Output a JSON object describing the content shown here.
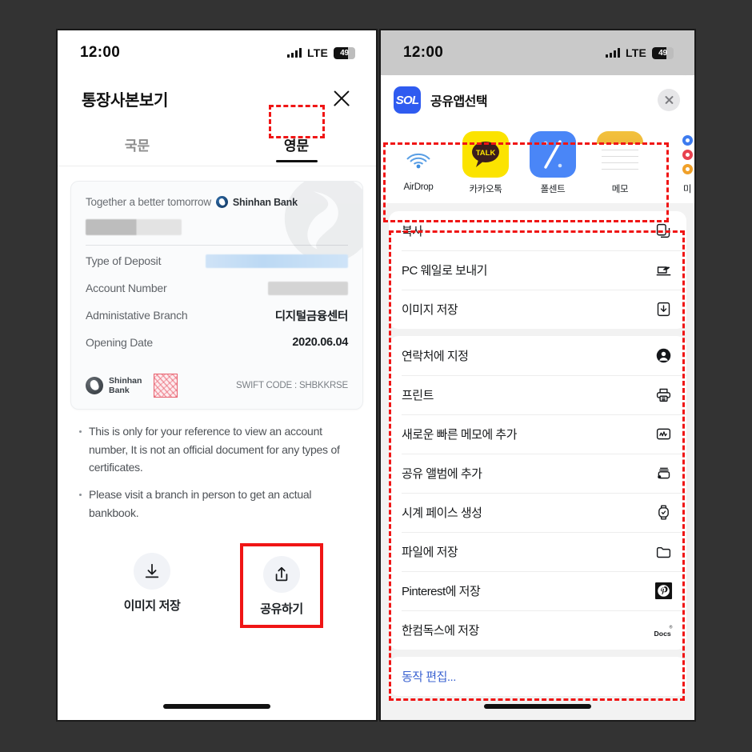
{
  "statusbar": {
    "time": "12:00",
    "network": "LTE",
    "battery": "49"
  },
  "left_phone": {
    "header": {
      "title": "통장사본보기",
      "close_icon": "close-icon"
    },
    "tabs": [
      {
        "label": "국문",
        "active": false
      },
      {
        "label": "영문",
        "active": true
      }
    ],
    "bank_card": {
      "tagline": "Together a better tomorrow",
      "brand": "Shinhan Bank",
      "name_masked": true,
      "rows": [
        {
          "label": "Type of Deposit",
          "value": "",
          "masked": "blue"
        },
        {
          "label": "Account Number",
          "value": "",
          "masked": "gray"
        },
        {
          "label": "Administative Branch",
          "value": "디지털금융센터",
          "masked": ""
        },
        {
          "label": "Opening Date",
          "value": "2020.06.04",
          "masked": ""
        }
      ],
      "footer_brand_line1": "Shinhan",
      "footer_brand_line2": "Bank",
      "swift": "SWIFT CODE : SHBKKRSE"
    },
    "notes": [
      "This is only for your reference to view an account number, It is not an official document for any types of certificates.",
      "Please visit a branch in person to get an actual bankbook."
    ],
    "actions": [
      {
        "label": "이미지 저장",
        "icon": "download-icon",
        "highlighted": false
      },
      {
        "label": "공유하기",
        "icon": "share-icon",
        "highlighted": true
      }
    ]
  },
  "right_phone": {
    "sheet_header": {
      "app_name": "SOL",
      "title": "공유앱선택",
      "close_icon": "close-icon"
    },
    "apps": [
      {
        "label": "AirDrop",
        "icon": "airdrop-icon"
      },
      {
        "label": "카카오톡",
        "icon": "kakaotalk-icon"
      },
      {
        "label": "폴센트",
        "icon": "polsent-icon"
      },
      {
        "label": "메모",
        "icon": "notes-icon"
      },
      {
        "label": "미",
        "icon": "reminders-icon"
      }
    ],
    "groups": [
      {
        "rows": [
          {
            "label": "복사",
            "icon": "copy-icon"
          },
          {
            "label": "PC 웨일로 보내기",
            "icon": "whale-send-icon"
          },
          {
            "label": "이미지 저장",
            "icon": "save-image-icon"
          }
        ]
      },
      {
        "rows": [
          {
            "label": "연락처에 지정",
            "icon": "contact-icon"
          },
          {
            "label": "프린트",
            "icon": "print-icon"
          },
          {
            "label": "새로운 빠른 메모에 추가",
            "icon": "quick-note-icon"
          },
          {
            "label": "공유 앨범에 추가",
            "icon": "shared-album-icon"
          },
          {
            "label": "시계 페이스 생성",
            "icon": "watch-face-icon"
          },
          {
            "label": "파일에 저장",
            "icon": "folder-icon"
          },
          {
            "label": "Pinterest에 저장",
            "icon": "pinterest-icon"
          },
          {
            "label": "한컴독스에 저장",
            "icon": "hancom-docs-icon"
          }
        ]
      },
      {
        "rows": [
          {
            "label": "동작 편집...",
            "icon": "",
            "edit": true
          }
        ]
      }
    ]
  },
  "annotations": {
    "accent_red": "#f01515",
    "boxes": [
      {
        "name": "tab-english-highlight",
        "style": "dashed"
      },
      {
        "name": "share-apps-highlight",
        "style": "dashed"
      },
      {
        "name": "share-actions-highlight",
        "style": "dashed"
      },
      {
        "name": "share-button-highlight",
        "style": "solid"
      }
    ]
  }
}
